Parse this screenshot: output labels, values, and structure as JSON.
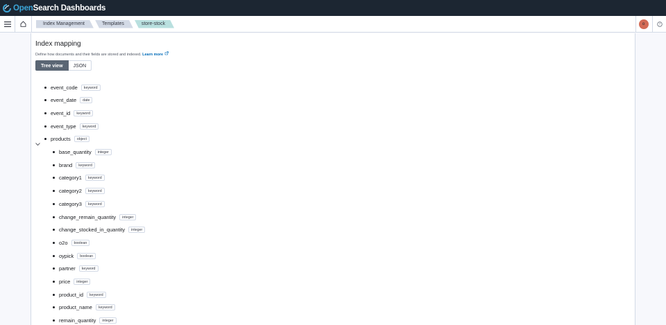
{
  "brand": {
    "part1": "Open",
    "part2": "Search Dashboards"
  },
  "breadcrumbs": [
    "Index Management",
    "Templates",
    "store-stock"
  ],
  "user": {
    "avatar_initial": "o"
  },
  "page": {
    "title": "Index mapping",
    "description": "Define how documents and their fields are stored and indexed.",
    "learn_more": "Learn more",
    "view_tabs": [
      "Tree view",
      "JSON"
    ]
  },
  "fields": [
    {
      "name": "event_code",
      "type": "keyword"
    },
    {
      "name": "event_date",
      "type": "date"
    },
    {
      "name": "event_id",
      "type": "keyword"
    },
    {
      "name": "event_type",
      "type": "keyword"
    },
    {
      "name": "products",
      "type": "object"
    }
  ],
  "product_fields": [
    {
      "name": "base_quantity",
      "type": "integer"
    },
    {
      "name": "brand",
      "type": "keyword"
    },
    {
      "name": "category1",
      "type": "keyword"
    },
    {
      "name": "category2",
      "type": "keyword"
    },
    {
      "name": "category3",
      "type": "keyword"
    },
    {
      "name": "change_remain_quantity",
      "type": "integer"
    },
    {
      "name": "change_stocked_in_quantity",
      "type": "integer"
    },
    {
      "name": "o2o",
      "type": "boolean"
    },
    {
      "name": "oypick",
      "type": "boolean"
    },
    {
      "name": "partner",
      "type": "keyword"
    },
    {
      "name": "price",
      "type": "integer"
    },
    {
      "name": "product_id",
      "type": "keyword"
    },
    {
      "name": "product_name",
      "type": "keyword"
    },
    {
      "name": "remain_quantity",
      "type": "integer"
    }
  ]
}
